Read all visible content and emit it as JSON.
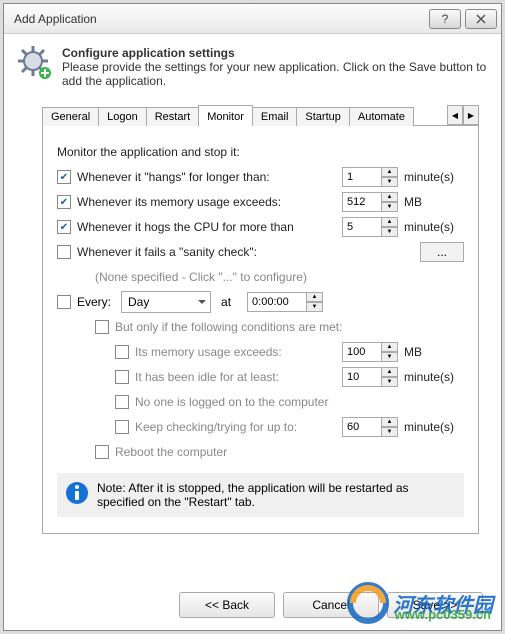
{
  "window": {
    "title": "Add Application"
  },
  "header": {
    "title": "Configure application settings",
    "subtitle": "Please provide the settings for your new application. Click on the Save button to add the application."
  },
  "tabs": {
    "items": [
      "General",
      "Logon",
      "Restart",
      "Monitor",
      "Email",
      "Startup",
      "Automate"
    ],
    "active": 3
  },
  "monitor": {
    "intro": "Monitor the application and stop it:",
    "hangs": {
      "checked": true,
      "label": "Whenever it \"hangs\" for longer than:",
      "value": "1",
      "unit": "minute(s)"
    },
    "memory": {
      "checked": true,
      "label": "Whenever its memory usage exceeds:",
      "value": "512",
      "unit": "MB"
    },
    "cpu": {
      "checked": true,
      "label": "Whenever it hogs the CPU for more than",
      "value": "5",
      "unit": "minute(s)"
    },
    "sanity": {
      "checked": false,
      "label": "Whenever it fails a \"sanity check\":",
      "button": "..."
    },
    "sanity_hint": "(None specified - Click \"...\" to configure)",
    "every": {
      "checked": false,
      "label": "Every:",
      "period": "Day",
      "at_label": "at",
      "time": "0:00:00"
    },
    "cond_intro": "But only if the following conditions are met:",
    "cond_mem": {
      "checked": false,
      "label": "Its memory usage exceeds:",
      "value": "100",
      "unit": "MB"
    },
    "cond_idle": {
      "checked": false,
      "label": "It has been idle for at least:",
      "value": "10",
      "unit": "minute(s)"
    },
    "cond_nouser": {
      "checked": false,
      "label": "No one is logged on to the computer"
    },
    "cond_keep": {
      "checked": false,
      "label": "Keep checking/trying for up to:",
      "value": "60",
      "unit": "minute(s)"
    },
    "reboot": {
      "checked": false,
      "label": "Reboot the computer"
    },
    "note": "Note: After it is stopped, the application will be restarted as specified on the \"Restart\" tab."
  },
  "footer": {
    "back": "<< Back",
    "cancel": "Cancel",
    "save": "Save >>"
  },
  "watermark": {
    "name": "河东软件园",
    "url": "www.pc0359.cn"
  }
}
